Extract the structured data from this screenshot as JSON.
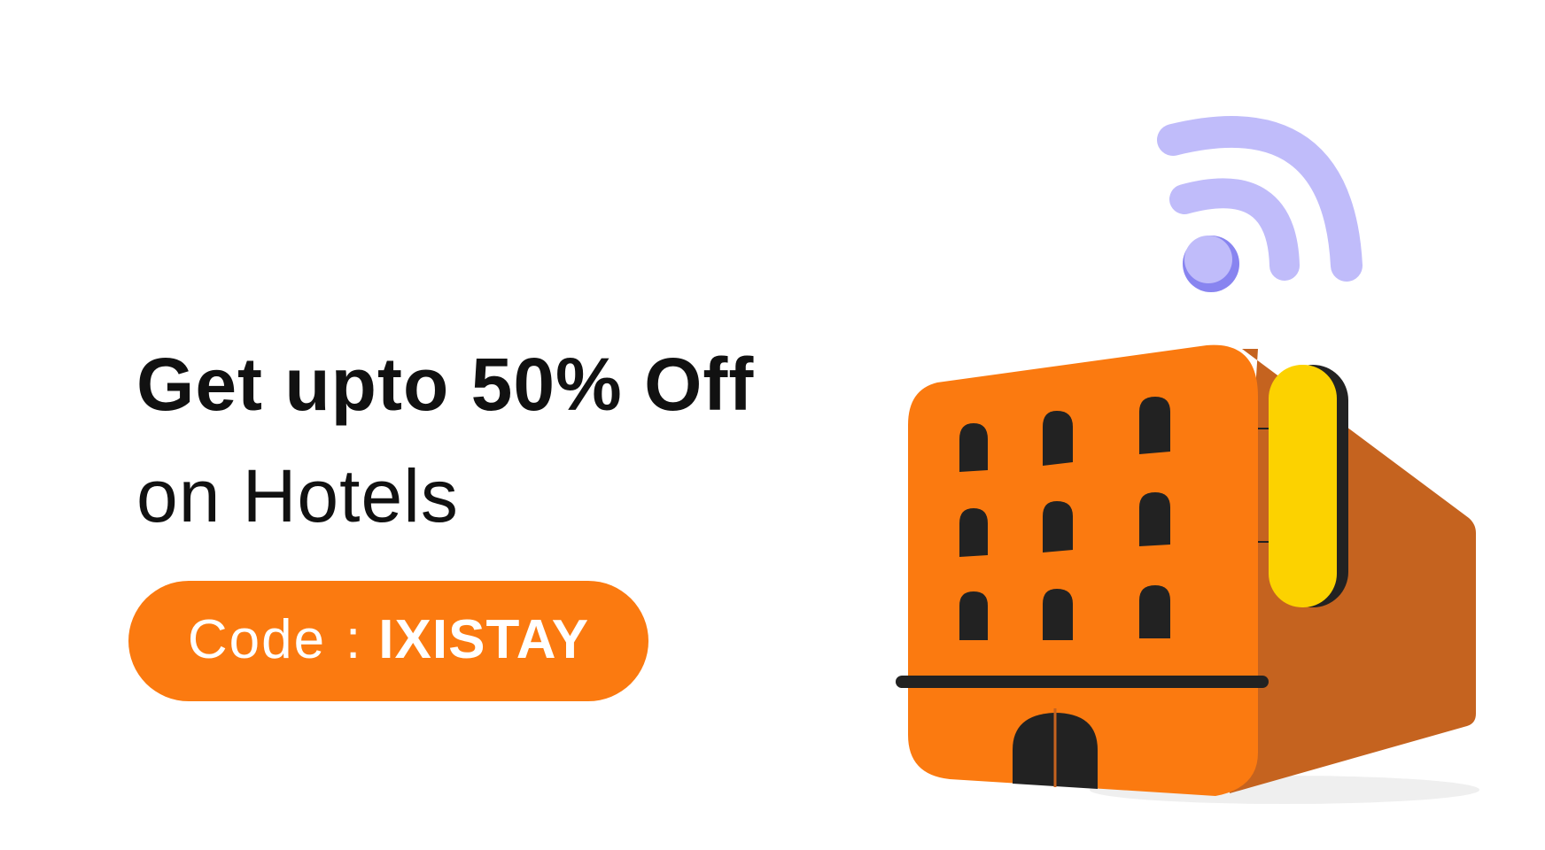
{
  "banner": {
    "headline_bold": "Get upto 50% Off",
    "headline_regular": "on Hotels",
    "code_label": "Code",
    "code_separator": ":",
    "code_value": "IXISTAY"
  },
  "illustration": {
    "building_color": "#fb7a10",
    "building_side_color": "#c5631f",
    "sign_color": "#fcd200",
    "wifi_color": "#c0bcfa",
    "window_color": "#222222",
    "icons": [
      "hotel-building-icon",
      "wifi-icon"
    ]
  },
  "colors": {
    "accent": "#fb7a10",
    "text": "#111111",
    "background": "#ffffff"
  }
}
